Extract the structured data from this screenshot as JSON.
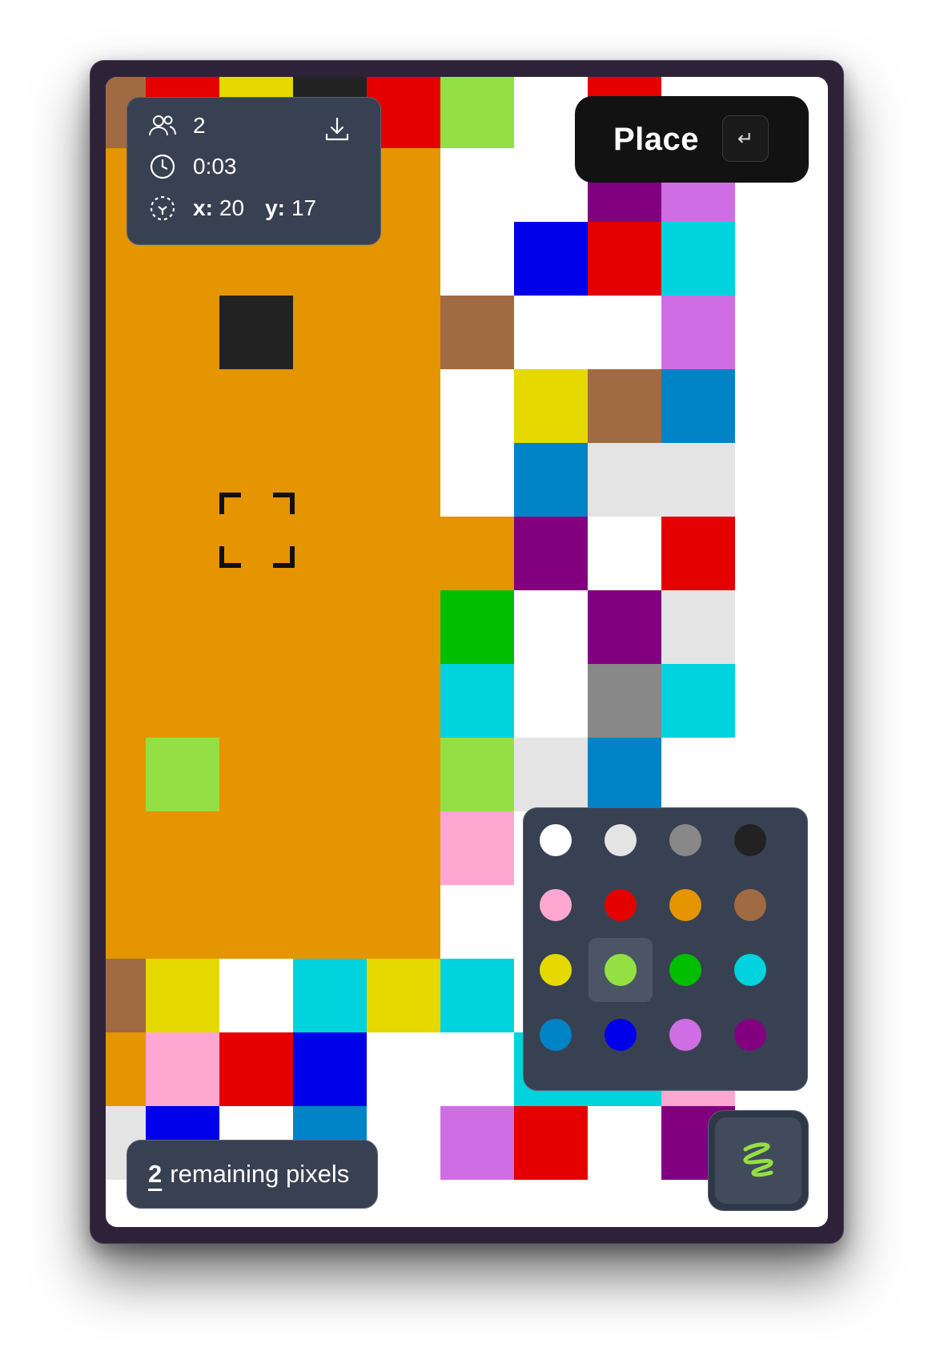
{
  "app": {
    "place_label": "Place",
    "enter_key": "↵",
    "users_icon": "users-icon",
    "download_icon": "download-icon"
  },
  "stats": {
    "user_count": "2",
    "timer": "0:03",
    "x_label": "x:",
    "x_value": "20",
    "y_label": "y:",
    "y_value": "17"
  },
  "remaining": {
    "count": "2",
    "label": "remaining pixels"
  },
  "palette": {
    "selected": "#94E044",
    "colors": [
      "#FFFFFF",
      "#E4E4E4",
      "#888888",
      "#222222",
      "#FFA7D1",
      "#E50000",
      "#E59500",
      "#A06A42",
      "#E5D900",
      "#94E044",
      "#02BE01",
      "#00D3DD",
      "#0083C7",
      "#0000EA",
      "#CF6EE4",
      "#820080"
    ]
  },
  "canvas": {
    "cols": 9,
    "rows": 15,
    "cells": [
      [
        "#A06A42",
        "#E50000",
        "#E5D900",
        "#222222",
        "#E50000",
        "#94E044",
        "#FFFFFF",
        "#E50000",
        "#FFFFFF"
      ],
      [
        "#E59500",
        "#E59500",
        "#E59500",
        "#E59500",
        "#E59500",
        "#FFFFFF",
        "#FFFFFF",
        "#820080",
        "#CF6EE4"
      ],
      [
        "#E59500",
        "#E59500",
        "#E59500",
        "#E59500",
        "#E59500",
        "#FFFFFF",
        "#0000EA",
        "#E50000",
        "#00D3DD"
      ],
      [
        "#E59500",
        "#E59500",
        "#222222",
        "#E59500",
        "#E59500",
        "#A06A42",
        "#FFFFFF",
        "#FFFFFF",
        "#CF6EE4"
      ],
      [
        "#E59500",
        "#E59500",
        "#E59500",
        "#E59500",
        "#E59500",
        "#FFFFFF",
        "#E5D900",
        "#A06A42",
        "#0083C7"
      ],
      [
        "#E59500",
        "#E59500",
        "#E59500",
        "#E59500",
        "#E59500",
        "#FFFFFF",
        "#0083C7",
        "#E4E4E4",
        "#E4E4E4"
      ],
      [
        "#E59500",
        "#E59500",
        "#E59500",
        "#E59500",
        "#E59500",
        "#E59500",
        "#820080",
        "#FFFFFF",
        "#E50000"
      ],
      [
        "#E59500",
        "#E59500",
        "#E59500",
        "#E59500",
        "#E59500",
        "#02BE01",
        "#FFFFFF",
        "#820080",
        "#E4E4E4"
      ],
      [
        "#E59500",
        "#E59500",
        "#E59500",
        "#E59500",
        "#E59500",
        "#00D3DD",
        "#FFFFFF",
        "#888888",
        "#00D3DD"
      ],
      [
        "#E59500",
        "#94E044",
        "#E59500",
        "#E59500",
        "#E59500",
        "#94E044",
        "#E4E4E4",
        "#0083C7",
        "#FFFFFF"
      ],
      [
        "#E59500",
        "#E59500",
        "#E59500",
        "#E59500",
        "#E59500",
        "#FFA7D1",
        "#FFFFFF",
        "#FFFFFF",
        "#FFFFFF"
      ],
      [
        "#E59500",
        "#E59500",
        "#E59500",
        "#E59500",
        "#E59500",
        "#FFFFFF",
        "#FFFFFF",
        "#FFFFFF",
        "#FFFFFF"
      ],
      [
        "#A06A42",
        "#E5D900",
        "#FFFFFF",
        "#00D3DD",
        "#E5D900",
        "#00D3DD",
        "#FFFFFF",
        "#FFFFFF",
        "#820080"
      ],
      [
        "#E59500",
        "#FFA7D1",
        "#E50000",
        "#0000EA",
        "#FFFFFF",
        "#FFFFFF",
        "#00D3DD",
        "#00D3DD",
        "#FFA7D1"
      ],
      [
        "#E4E4E4",
        "#0000EA",
        "#FFFFFF",
        "#0083C7",
        "#FFFFFF",
        "#CF6EE4",
        "#E50000",
        "#FFFFFF",
        "#820080"
      ]
    ]
  }
}
